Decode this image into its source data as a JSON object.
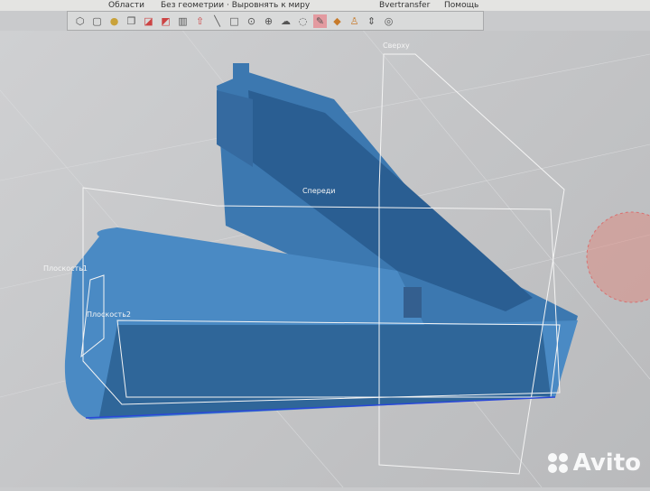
{
  "menu": {
    "items": [
      "Области",
      "Без геометрии · Выровнять к миру",
      "Bvertransfer",
      "Помощь"
    ]
  },
  "toolbar": {
    "icons": [
      "polygon-icon",
      "box-icon",
      "object-icon",
      "copy-icon",
      "plane-icon",
      "plane2-icon",
      "split-icon",
      "extrude-icon",
      "line-icon",
      "rect-icon",
      "circle-icon",
      "circle2-icon",
      "lasso-icon",
      "lasso2-icon",
      "brush-icon",
      "fill-icon",
      "smooth-icon",
      "scale-icon",
      "visibility-icon"
    ],
    "active": "brush-icon"
  },
  "viewport": {
    "labels": {
      "top": "Сверху",
      "front": "Спереди",
      "plane1": "Плоскость1",
      "plane2": "Плоскость2"
    }
  },
  "watermark": "Avito",
  "colors": {
    "model": "#3f7fb8",
    "accent": "#e39aa0"
  }
}
